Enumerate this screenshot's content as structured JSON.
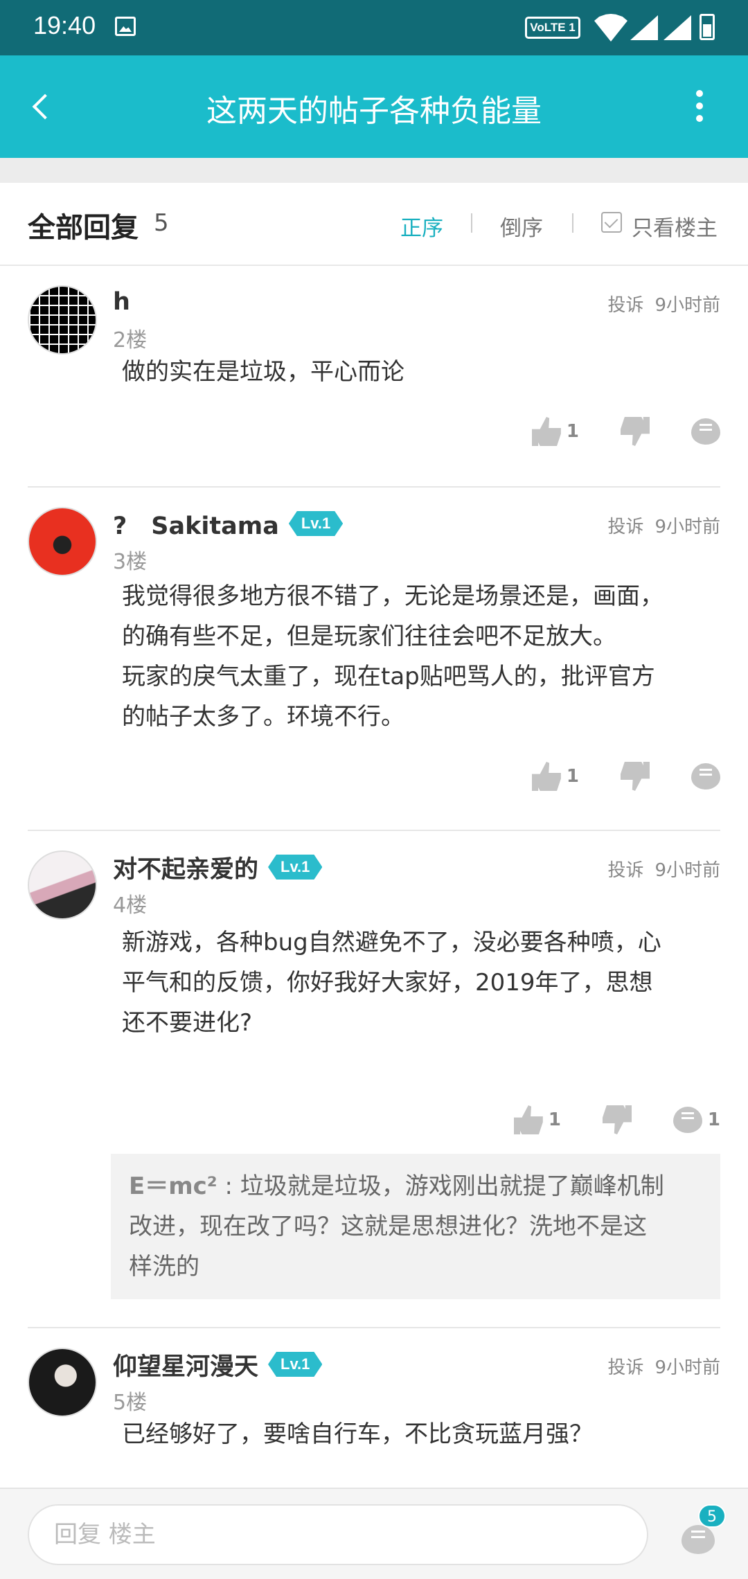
{
  "status_bar": {
    "time": "19:40",
    "network_badge": "VoLTE 1"
  },
  "app_bar": {
    "title": "这两天的帖子各种负能量"
  },
  "reply_header": {
    "label": "全部回复",
    "count": "5",
    "sort_asc": "正序",
    "sort_desc": "倒序",
    "only_op": "只看楼主"
  },
  "posts": [
    {
      "name": "h",
      "floor": "2楼",
      "report": "投诉",
      "time": "9小时前",
      "lines": [
        "做的实在是垃圾，平心而论"
      ],
      "likes": "1",
      "comments": ""
    },
    {
      "name": "?　Sakitama",
      "level": "Lv.1",
      "floor": "3楼",
      "report": "投诉",
      "time": "9小时前",
      "lines": [
        "我觉得很多地方很不错了，无论是场景还是，画面，",
        "的确有些不足，但是玩家们往往会吧不足放大。",
        "玩家的戾气太重了，现在tap贴吧骂人的，批评官方",
        "的帖子太多了。环境不行。"
      ],
      "likes": "1",
      "comments": ""
    },
    {
      "name": "对不起亲爱的",
      "level": "Lv.1",
      "floor": "4楼",
      "report": "投诉",
      "time": "9小时前",
      "lines": [
        "新游戏，各种bug自然避免不了，没必要各种喷，心",
        "平气和的反馈，你好我好大家好，2019年了，思想",
        "还不要进化?"
      ],
      "likes": "1",
      "comments": "1",
      "sub_reply": {
        "author": "E＝mc²",
        "lines": [
          " : 垃圾就是垃圾，游戏刚出就提了巅峰机制",
          "改进，现在改了吗？这就是思想进化？洗地不是这",
          "样洗的"
        ]
      }
    },
    {
      "name": "仰望星河漫天",
      "level": "Lv.1",
      "floor": "5楼",
      "report": "投诉",
      "time": "9小时前",
      "lines": [
        "已经够好了，要啥自行车，不比贪玩蓝月强？"
      ]
    }
  ],
  "bottom_bar": {
    "placeholder": "回复  楼主",
    "badge": "5"
  },
  "colors": {
    "accent": "#1bbccb",
    "status_bar": "#116b76"
  }
}
